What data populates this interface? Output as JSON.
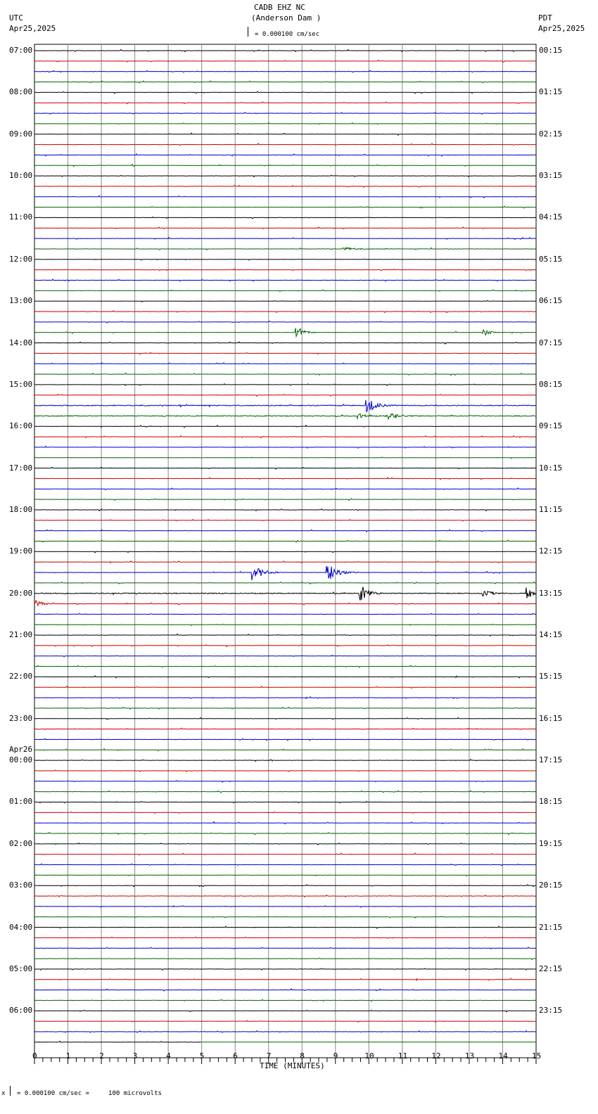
{
  "header": {
    "title": "CADB EHZ NC",
    "subtitle": "(Anderson Dam )",
    "left_tz": "UTC",
    "left_date": "Apr25,2025",
    "right_tz": "PDT",
    "right_date": "Apr25,2025",
    "scale": "= 0.000100 cm/sec"
  },
  "footer": {
    "scale_note": "= 0.000100 cm/sec =     100 microvolts",
    "marker": "x"
  },
  "chart_data": {
    "type": "line",
    "title": "CADB EHZ NC (Anderson Dam )",
    "xlabel": "TIME (MINUTES)",
    "xlim": [
      0,
      15
    ],
    "x_ticks": [
      "0",
      "1",
      "2",
      "3",
      "4",
      "5",
      "6",
      "7",
      "8",
      "9",
      "10",
      "11",
      "12",
      "13",
      "14",
      "15"
    ],
    "traces_per_hour": 4,
    "trace_colors": [
      "#000000",
      "#cc0000",
      "#0000cc",
      "#006600"
    ],
    "left_labels": [
      "07:00",
      "08:00",
      "09:00",
      "10:00",
      "11:00",
      "12:00",
      "13:00",
      "14:00",
      "15:00",
      "16:00",
      "17:00",
      "18:00",
      "19:00",
      "20:00",
      "21:00",
      "22:00",
      "23:00",
      "00:00",
      "01:00",
      "02:00",
      "03:00",
      "04:00",
      "05:00",
      "06:00"
    ],
    "date_change_label": "Apr26",
    "right_labels": [
      "00:15",
      "01:15",
      "02:15",
      "03:15",
      "04:15",
      "05:15",
      "06:15",
      "07:15",
      "08:15",
      "09:15",
      "10:15",
      "11:15",
      "12:15",
      "13:15",
      "14:15",
      "15:15",
      "16:15",
      "17:15",
      "18:15",
      "19:15",
      "20:15",
      "21:15",
      "22:15",
      "23:15"
    ],
    "events": [
      {
        "trace": 19,
        "minute": 9.3,
        "duration": 1.5,
        "amplitude": 4
      },
      {
        "trace": 27,
        "minute": 7.9,
        "duration": 0.6,
        "amplitude": 14
      },
      {
        "trace": 27,
        "minute": 13.5,
        "duration": 0.6,
        "amplitude": 7
      },
      {
        "trace": 34,
        "minute": 10.0,
        "duration": 0.7,
        "amplitude": 18
      },
      {
        "trace": 35,
        "minute": 9.7,
        "duration": 0.6,
        "amplitude": 8
      },
      {
        "trace": 35,
        "minute": 10.6,
        "duration": 0.8,
        "amplitude": 8
      },
      {
        "trace": 50,
        "minute": 6.6,
        "duration": 0.8,
        "amplitude": 22
      },
      {
        "trace": 50,
        "minute": 8.8,
        "duration": 0.8,
        "amplitude": 26
      },
      {
        "trace": 52,
        "minute": 9.8,
        "duration": 0.6,
        "amplitude": 20
      },
      {
        "trace": 52,
        "minute": 13.5,
        "duration": 0.6,
        "amplitude": 7
      },
      {
        "trace": 52,
        "minute": 14.8,
        "duration": 0.3,
        "amplitude": 16
      },
      {
        "trace": 53,
        "minute": 0.1,
        "duration": 0.5,
        "amplitude": 10
      }
    ]
  }
}
